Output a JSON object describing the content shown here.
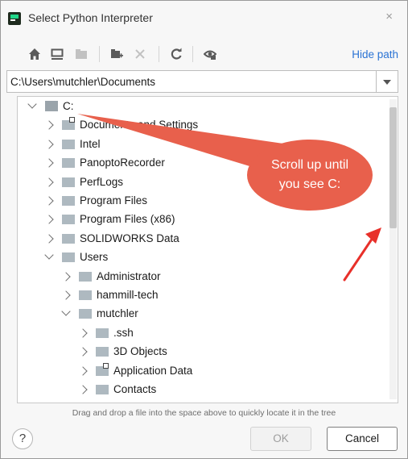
{
  "window": {
    "title": "Select Python Interpreter",
    "close_glyph": "×"
  },
  "toolbar": {
    "icons": [
      "home-icon",
      "desktop-icon",
      "project-icon",
      "new-folder-icon",
      "delete-icon",
      "refresh-icon",
      "show-hidden-icon"
    ],
    "hide_path_label": "Hide path"
  },
  "path": {
    "value": "C:\\Users\\mutchler\\Documents"
  },
  "tree": {
    "items": [
      {
        "label": "C:",
        "state": "expanded",
        "icon": "drive"
      },
      {
        "label": "Documents and Settings",
        "state": "collapsed",
        "icon": "folder-link"
      },
      {
        "label": "Intel",
        "state": "collapsed",
        "icon": "folder"
      },
      {
        "label": "PanoptoRecorder",
        "state": "collapsed",
        "icon": "folder"
      },
      {
        "label": "PerfLogs",
        "state": "collapsed",
        "icon": "folder"
      },
      {
        "label": "Program Files",
        "state": "collapsed",
        "icon": "folder"
      },
      {
        "label": "Program Files (x86)",
        "state": "collapsed",
        "icon": "folder"
      },
      {
        "label": "SOLIDWORKS Data",
        "state": "collapsed",
        "icon": "folder"
      },
      {
        "label": "Users",
        "state": "expanded",
        "icon": "folder"
      },
      {
        "label": "Administrator",
        "state": "collapsed",
        "icon": "folder"
      },
      {
        "label": "hammill-tech",
        "state": "collapsed",
        "icon": "folder"
      },
      {
        "label": "mutchler",
        "state": "expanded",
        "icon": "folder"
      },
      {
        "label": ".ssh",
        "state": "collapsed",
        "icon": "folder"
      },
      {
        "label": "3D Objects",
        "state": "collapsed",
        "icon": "folder"
      },
      {
        "label": "Application Data",
        "state": "collapsed",
        "icon": "folder-link"
      },
      {
        "label": "Contacts",
        "state": "collapsed",
        "icon": "folder"
      }
    ]
  },
  "hint": "Drag and drop a file into the space above to quickly locate it in the tree",
  "buttons": {
    "help_label": "?",
    "ok_label": "OK",
    "cancel_label": "Cancel"
  },
  "callout": {
    "line1": "Scroll up until",
    "line2": "you see C:",
    "color": "#e8604c"
  },
  "colors": {
    "accent": "#2a73d4",
    "callout": "#e8604c"
  }
}
